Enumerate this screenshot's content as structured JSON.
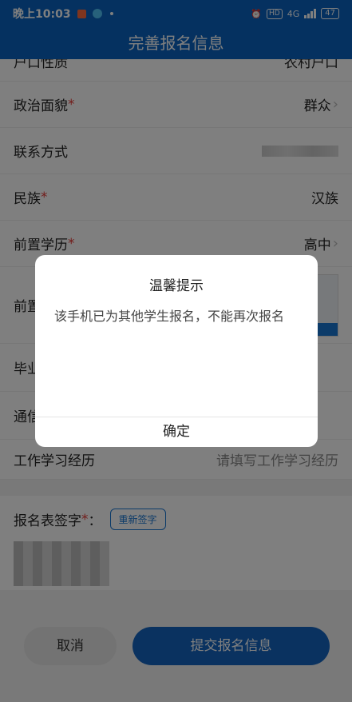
{
  "status_bar": {
    "time": "晚上10:03",
    "hd": "HD",
    "network": "4G",
    "battery": "47"
  },
  "header": {
    "title": "完善报名信息"
  },
  "form": {
    "rows": [
      {
        "label": "户口性质",
        "value": "农村户口"
      },
      {
        "label": "政治面貌",
        "required": "*",
        "value": "群众"
      },
      {
        "label": "联系方式"
      },
      {
        "label": "民族",
        "required": "*",
        "value": "汉族"
      },
      {
        "label": "前置学历",
        "required": "*",
        "value": "高中"
      },
      {
        "label": "前置"
      },
      {
        "label": "毕业"
      },
      {
        "label": "通信"
      },
      {
        "label": "工作学习经历",
        "placeholder": "请填写工作学习经历"
      }
    ]
  },
  "signature": {
    "label": "报名表签字",
    "required": "*",
    "colon": "：",
    "resign_label": "重新签字"
  },
  "actions": {
    "cancel_label": "取消",
    "submit_label": "提交报名信息"
  },
  "dialog": {
    "title": "温馨提示",
    "message": "该手机已为其他学生报名，不能再次报名",
    "confirm_label": "确定"
  },
  "colors": {
    "primary": "#0b63c0",
    "required": "#e53935",
    "submit": "#1565c0"
  }
}
